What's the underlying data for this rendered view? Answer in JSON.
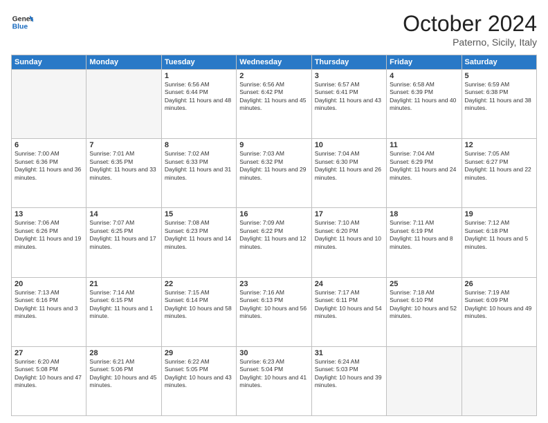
{
  "header": {
    "logo_line1": "General",
    "logo_line2": "Blue",
    "month": "October 2024",
    "location": "Paterno, Sicily, Italy"
  },
  "days_of_week": [
    "Sunday",
    "Monday",
    "Tuesday",
    "Wednesday",
    "Thursday",
    "Friday",
    "Saturday"
  ],
  "weeks": [
    [
      {
        "day": "",
        "empty": true
      },
      {
        "day": "",
        "empty": true
      },
      {
        "day": "1",
        "sunrise": "6:56 AM",
        "sunset": "6:44 PM",
        "daylight": "11 hours and 48 minutes."
      },
      {
        "day": "2",
        "sunrise": "6:56 AM",
        "sunset": "6:42 PM",
        "daylight": "11 hours and 45 minutes."
      },
      {
        "day": "3",
        "sunrise": "6:57 AM",
        "sunset": "6:41 PM",
        "daylight": "11 hours and 43 minutes."
      },
      {
        "day": "4",
        "sunrise": "6:58 AM",
        "sunset": "6:39 PM",
        "daylight": "11 hours and 40 minutes."
      },
      {
        "day": "5",
        "sunrise": "6:59 AM",
        "sunset": "6:38 PM",
        "daylight": "11 hours and 38 minutes."
      }
    ],
    [
      {
        "day": "6",
        "sunrise": "7:00 AM",
        "sunset": "6:36 PM",
        "daylight": "11 hours and 36 minutes."
      },
      {
        "day": "7",
        "sunrise": "7:01 AM",
        "sunset": "6:35 PM",
        "daylight": "11 hours and 33 minutes."
      },
      {
        "day": "8",
        "sunrise": "7:02 AM",
        "sunset": "6:33 PM",
        "daylight": "11 hours and 31 minutes."
      },
      {
        "day": "9",
        "sunrise": "7:03 AM",
        "sunset": "6:32 PM",
        "daylight": "11 hours and 29 minutes."
      },
      {
        "day": "10",
        "sunrise": "7:04 AM",
        "sunset": "6:30 PM",
        "daylight": "11 hours and 26 minutes."
      },
      {
        "day": "11",
        "sunrise": "7:04 AM",
        "sunset": "6:29 PM",
        "daylight": "11 hours and 24 minutes."
      },
      {
        "day": "12",
        "sunrise": "7:05 AM",
        "sunset": "6:27 PM",
        "daylight": "11 hours and 22 minutes."
      }
    ],
    [
      {
        "day": "13",
        "sunrise": "7:06 AM",
        "sunset": "6:26 PM",
        "daylight": "11 hours and 19 minutes."
      },
      {
        "day": "14",
        "sunrise": "7:07 AM",
        "sunset": "6:25 PM",
        "daylight": "11 hours and 17 minutes."
      },
      {
        "day": "15",
        "sunrise": "7:08 AM",
        "sunset": "6:23 PM",
        "daylight": "11 hours and 14 minutes."
      },
      {
        "day": "16",
        "sunrise": "7:09 AM",
        "sunset": "6:22 PM",
        "daylight": "11 hours and 12 minutes."
      },
      {
        "day": "17",
        "sunrise": "7:10 AM",
        "sunset": "6:20 PM",
        "daylight": "11 hours and 10 minutes."
      },
      {
        "day": "18",
        "sunrise": "7:11 AM",
        "sunset": "6:19 PM",
        "daylight": "11 hours and 8 minutes."
      },
      {
        "day": "19",
        "sunrise": "7:12 AM",
        "sunset": "6:18 PM",
        "daylight": "11 hours and 5 minutes."
      }
    ],
    [
      {
        "day": "20",
        "sunrise": "7:13 AM",
        "sunset": "6:16 PM",
        "daylight": "11 hours and 3 minutes."
      },
      {
        "day": "21",
        "sunrise": "7:14 AM",
        "sunset": "6:15 PM",
        "daylight": "11 hours and 1 minute."
      },
      {
        "day": "22",
        "sunrise": "7:15 AM",
        "sunset": "6:14 PM",
        "daylight": "10 hours and 58 minutes."
      },
      {
        "day": "23",
        "sunrise": "7:16 AM",
        "sunset": "6:13 PM",
        "daylight": "10 hours and 56 minutes."
      },
      {
        "day": "24",
        "sunrise": "7:17 AM",
        "sunset": "6:11 PM",
        "daylight": "10 hours and 54 minutes."
      },
      {
        "day": "25",
        "sunrise": "7:18 AM",
        "sunset": "6:10 PM",
        "daylight": "10 hours and 52 minutes."
      },
      {
        "day": "26",
        "sunrise": "7:19 AM",
        "sunset": "6:09 PM",
        "daylight": "10 hours and 49 minutes."
      }
    ],
    [
      {
        "day": "27",
        "sunrise": "6:20 AM",
        "sunset": "5:08 PM",
        "daylight": "10 hours and 47 minutes."
      },
      {
        "day": "28",
        "sunrise": "6:21 AM",
        "sunset": "5:06 PM",
        "daylight": "10 hours and 45 minutes."
      },
      {
        "day": "29",
        "sunrise": "6:22 AM",
        "sunset": "5:05 PM",
        "daylight": "10 hours and 43 minutes."
      },
      {
        "day": "30",
        "sunrise": "6:23 AM",
        "sunset": "5:04 PM",
        "daylight": "10 hours and 41 minutes."
      },
      {
        "day": "31",
        "sunrise": "6:24 AM",
        "sunset": "5:03 PM",
        "daylight": "10 hours and 39 minutes."
      },
      {
        "day": "",
        "empty": true
      },
      {
        "day": "",
        "empty": true
      }
    ]
  ]
}
